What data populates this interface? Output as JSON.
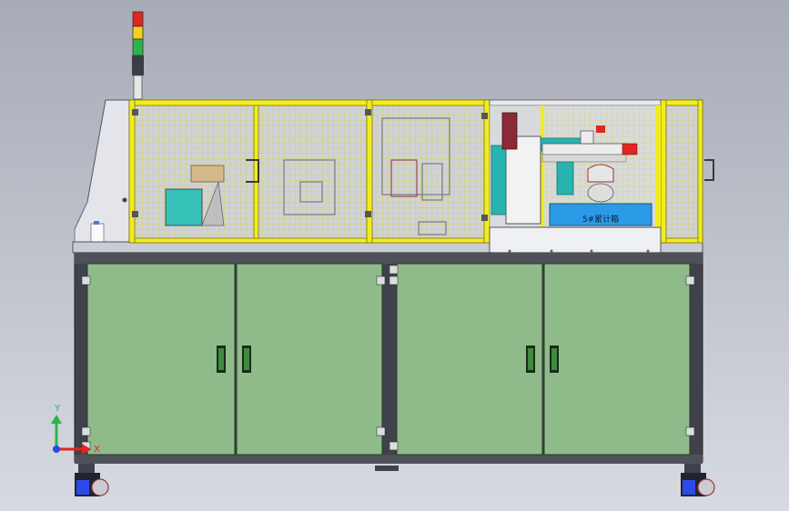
{
  "viewport": {
    "background_top": "#a6abb6",
    "background_bottom": "#d7dae1"
  },
  "colors": {
    "frame_yellow": "#f2ec1d",
    "frame_yellow_dark": "#b8b21a",
    "cabinet_green": "#8fbb8a",
    "cabinet_green_dark": "#6f9d6a",
    "steel": "#5a5d66",
    "steel_light": "#c9ccd4",
    "mesh": "#e8e24a",
    "teal": "#27b3b0",
    "blue_tray": "#2b9be8",
    "signal_red": "#e0261f",
    "signal_yellow": "#f3d11a",
    "signal_green": "#2eb34a",
    "axis_x": "#e0261f",
    "axis_y": "#2eb34a",
    "axis_z": "#2b4ae8"
  },
  "machine": {
    "tray_label": "5#累计箱",
    "signal_tower": [
      "red",
      "yellow",
      "green"
    ]
  },
  "triad": {
    "x_label": "X",
    "y_label": "Y"
  }
}
